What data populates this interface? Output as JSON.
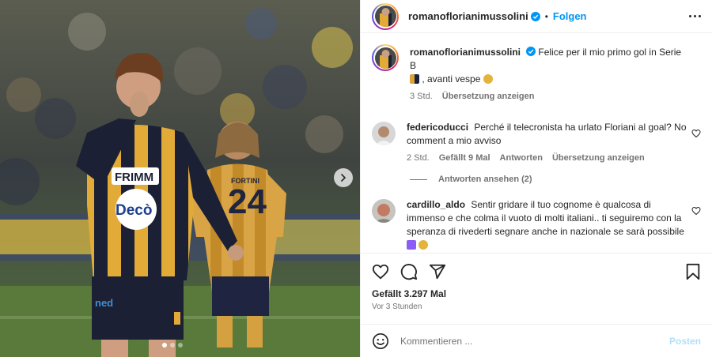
{
  "post": {
    "author": "romanoflorianimussolini",
    "follow_label": "Folgen",
    "separator": "•",
    "media": {
      "jersey_sponsor": "FRIMM",
      "jersey_sponsor_2": "Decò",
      "player_number": "24",
      "player_back_name": "FORTINI",
      "shorts_brand": "ned",
      "slide_count": 3,
      "active_slide": 1
    }
  },
  "caption": {
    "username": "romanoflorianimussolini",
    "text": "Felice per il mio primo gol in Serie B",
    "text_2": ", avanti vespe",
    "time": "3 Std.",
    "translate_label": "Übersetzung anzeigen"
  },
  "comments": [
    {
      "username": "federicoducci",
      "text": "Perché il telecronista ha urlato Floriani al goal? No comment a mio avviso",
      "time": "2 Std.",
      "likes": "Gefällt 9 Mal",
      "reply_label": "Antworten",
      "translate_label": "Übersetzung anzeigen",
      "view_replies_label": "Antworten ansehen (2)"
    },
    {
      "username": "cardillo_aldo",
      "text": "Sentir gridare il tuo cognome è qualcosa di immenso e che colma il vuoto di molti italiani.. ti seguiremo con la speranza di rivederti segnare anche in nazionale se sarà possibile"
    }
  ],
  "actions": {
    "likes_text": "Gefällt 3.297 Mal",
    "time_text": "Vor 3 Stunden"
  },
  "add_comment": {
    "placeholder": "Kommentieren ...",
    "post_label": "Posten"
  },
  "colors": {
    "accent": "#0095f6",
    "post_disabled": "#b2dffc",
    "verified": "#0095f6",
    "jersey_yellow": "#e8b23a",
    "jersey_navy": "#1c2340"
  },
  "icons": [
    "heart-icon",
    "comment-icon",
    "share-icon",
    "bookmark-icon",
    "emoji-icon",
    "more-icon",
    "verified-icon",
    "chevron-right-icon"
  ]
}
